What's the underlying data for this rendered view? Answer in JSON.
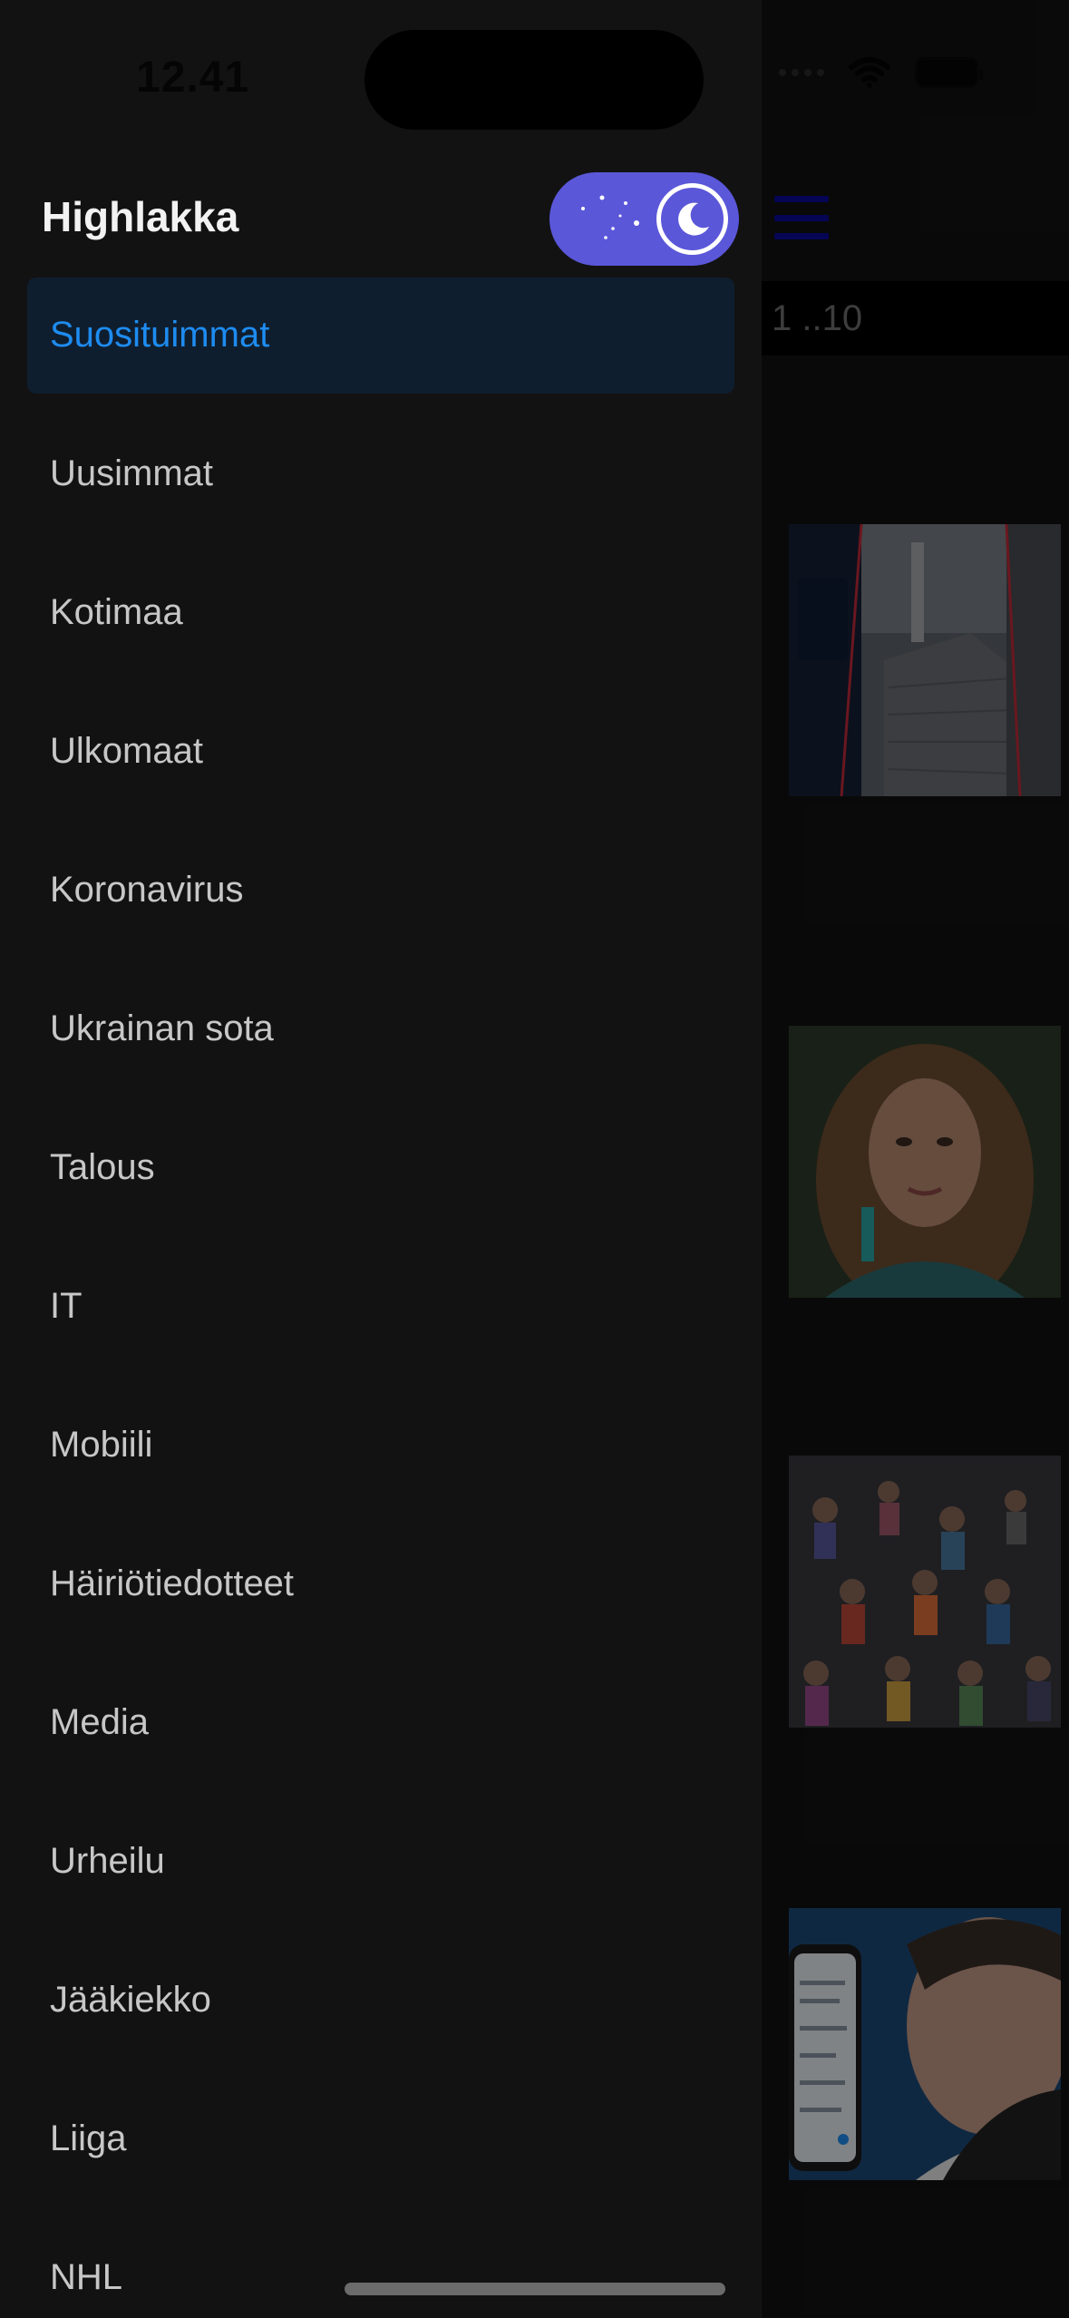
{
  "status_bar": {
    "time": "12.41"
  },
  "app": {
    "title": "Highlakka"
  },
  "theme_toggle": {
    "mode": "dark",
    "knob_icon": "moon-icon",
    "accent_color": "#5b57d9"
  },
  "menu": {
    "active_color": "#1e8cf0",
    "items": [
      {
        "label": "Suosituimmat",
        "active": true
      },
      {
        "label": "Uusimmat"
      },
      {
        "label": "Kotimaa"
      },
      {
        "label": "Ulkomaat"
      },
      {
        "label": "Koronavirus"
      },
      {
        "label": "Ukrainan sota"
      },
      {
        "label": "Talous"
      },
      {
        "label": "IT"
      },
      {
        "label": "Mobiili"
      },
      {
        "label": "Häiriötiedotteet"
      },
      {
        "label": "Media"
      },
      {
        "label": "Urheilu"
      },
      {
        "label": "Jääkiekko"
      },
      {
        "label": "Liiga"
      },
      {
        "label": "NHL"
      }
    ]
  },
  "background": {
    "range_label": "1 ..10",
    "icons": [
      "hamburger-icon",
      "wifi-icon",
      "battery-icon"
    ],
    "thumbnails": [
      {
        "subject": "nuclear power plant building"
      },
      {
        "subject": "woman portrait"
      },
      {
        "subject": "crowd of people"
      },
      {
        "subject": "man with smartphone"
      }
    ]
  }
}
